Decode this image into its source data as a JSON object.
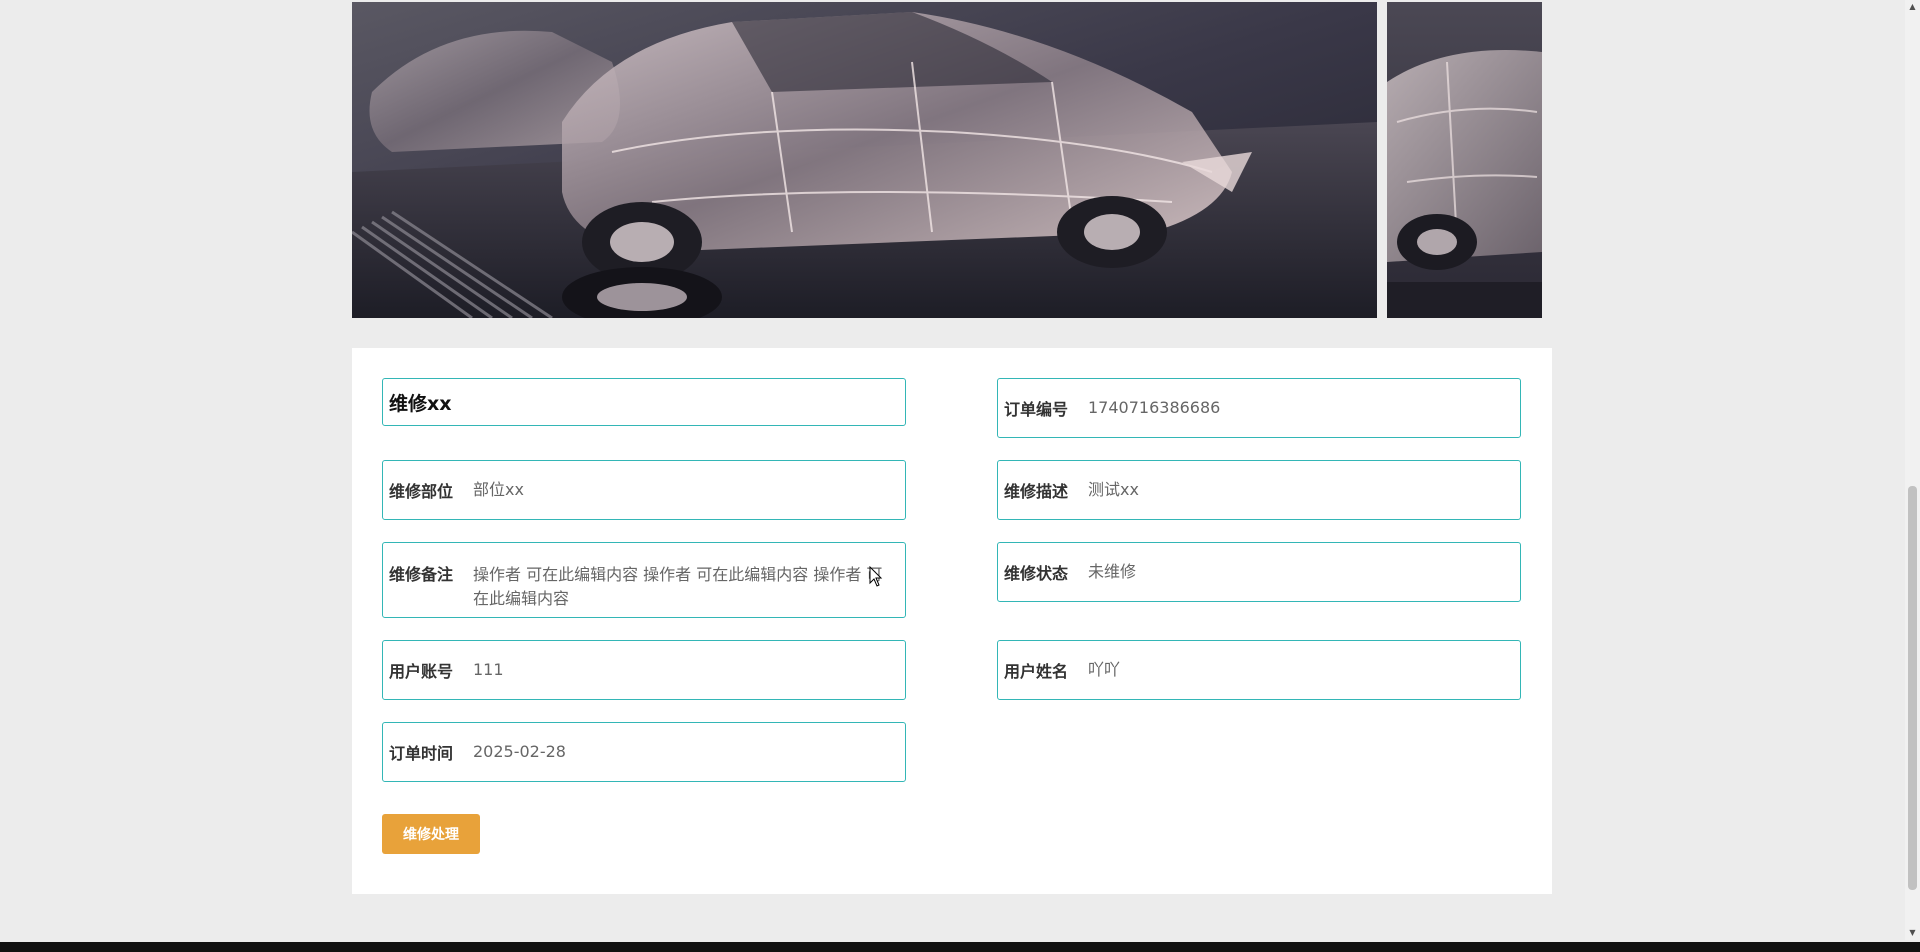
{
  "banner": {
    "slides": [
      "car-assembly-line",
      "car-assembly-line"
    ]
  },
  "detail": {
    "title": "维修xx",
    "fields": {
      "order_no": {
        "label": "订单编号",
        "value": "1740716386686"
      },
      "part": {
        "label": "维修部位",
        "value": "部位xx"
      },
      "description": {
        "label": "维修描述",
        "value": "测试xx"
      },
      "remark": {
        "label": "维修备注",
        "value": "操作者 可在此编辑内容 操作者 可在此编辑内容 操作者 可在此编辑内容"
      },
      "status": {
        "label": "维修状态",
        "value": "未维修"
      },
      "user_account": {
        "label": "用户账号",
        "value": "111"
      },
      "user_name": {
        "label": "用户姓名",
        "value": "吖吖"
      },
      "order_time": {
        "label": "订单时间",
        "value": "2025-02-28"
      }
    },
    "action_button": "维修处理"
  },
  "colors": {
    "border": "#33b6b6",
    "button": "#e8a23a",
    "background": "#ececec"
  }
}
